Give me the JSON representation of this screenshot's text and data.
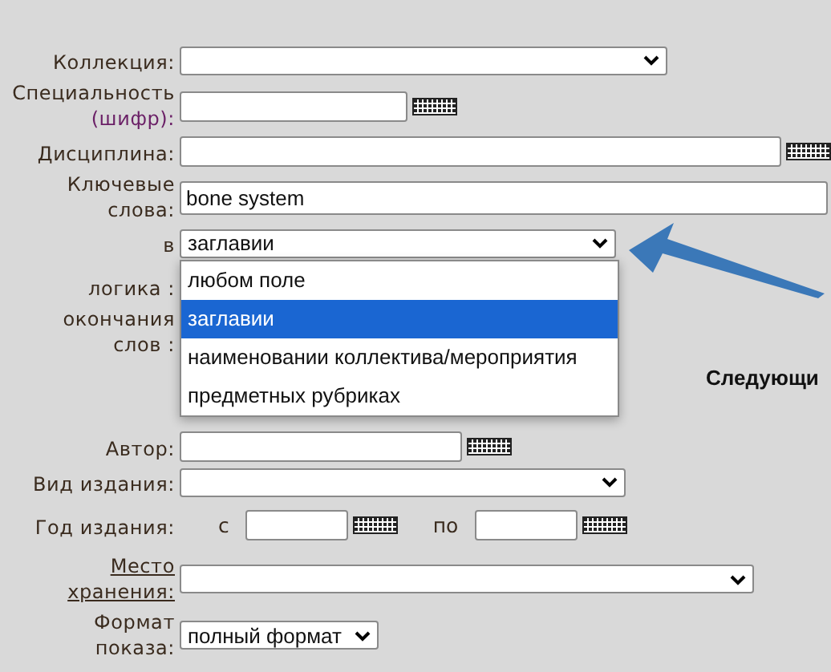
{
  "fields": [
    {
      "kind": "select",
      "label_lines": [
        "Коллекция:"
      ]
    },
    {
      "kind": "text",
      "label_lines": [
        "Специальность"
      ],
      "label_note": "(шифр):",
      "keyboard": true
    },
    {
      "kind": "text",
      "label_lines": [
        "Дисциплина:"
      ],
      "keyboard": true
    },
    {
      "kind": "text",
      "label_lines": [
        "Ключевые",
        "слова:"
      ],
      "value": "bone system"
    },
    {
      "kind": "select",
      "label_lines": [
        "в"
      ],
      "value": "заглавии",
      "open": true,
      "options": [
        {
          "label": "любом поле",
          "selected": false
        },
        {
          "label": "заглавии",
          "selected": true
        },
        {
          "label": "наименовании коллектива/мероприятия",
          "selected": false
        },
        {
          "label": "предметных рубриках",
          "selected": false
        }
      ]
    },
    {
      "kind": "hidden",
      "label_lines": [
        "логика :"
      ]
    },
    {
      "kind": "hidden",
      "label_lines": [
        "окончания",
        "слов :"
      ]
    },
    {
      "kind": "heading",
      "text": "Следующи"
    },
    {
      "kind": "text",
      "label_lines": [
        "Автор:"
      ],
      "keyboard": true
    },
    {
      "kind": "select",
      "label_lines": [
        "Вид издания:"
      ]
    },
    {
      "kind": "range",
      "label_lines": [
        "Год издания:"
      ],
      "from_label": "с",
      "to_label": "по"
    },
    {
      "kind": "select",
      "label_lines": [
        "Место",
        "хранения:"
      ],
      "link": true
    },
    {
      "kind": "select",
      "label_lines": [
        "Формат",
        "показа:"
      ],
      "value": "полный формат"
    }
  ]
}
